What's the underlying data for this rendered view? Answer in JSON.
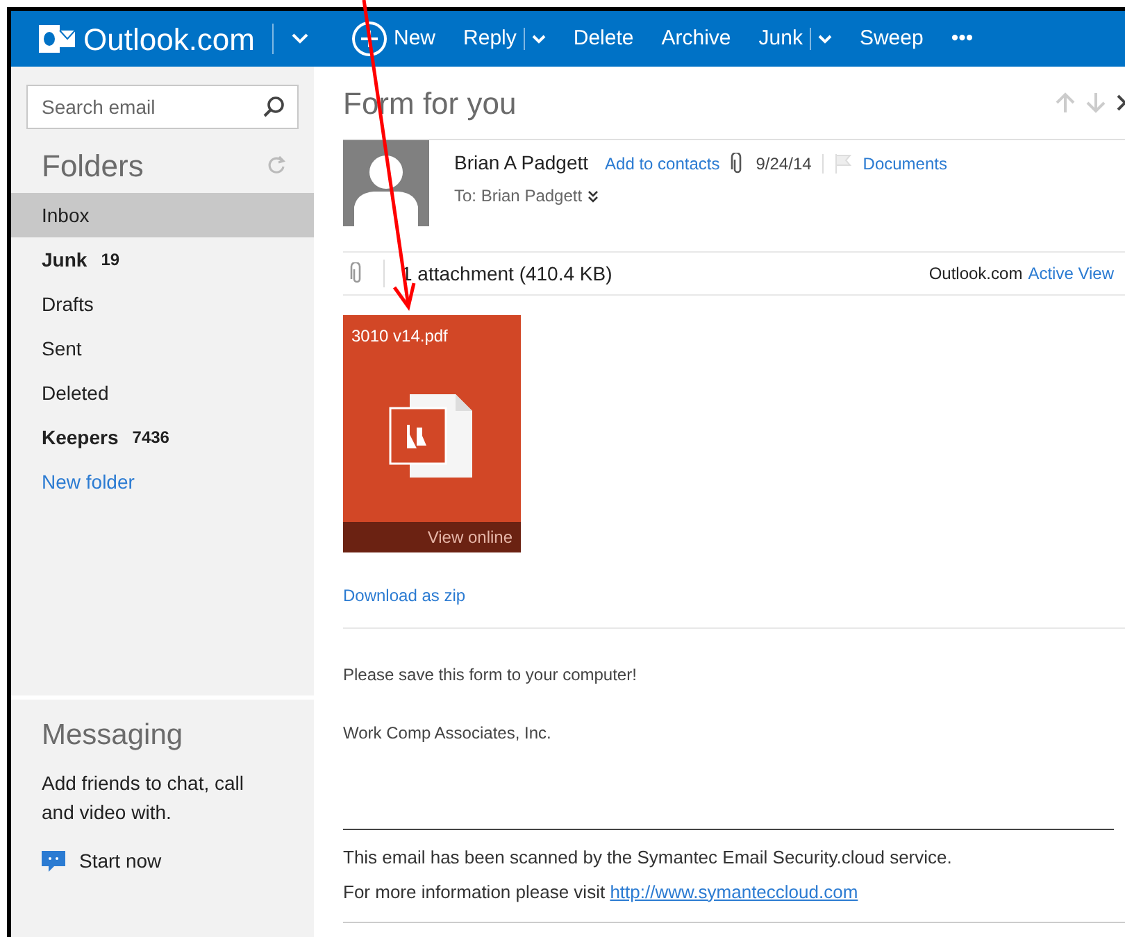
{
  "header": {
    "brand": "Outlook.com",
    "toolbar": [
      {
        "label": "New",
        "kind": "new",
        "has_menu": false
      },
      {
        "label": "Reply",
        "kind": "plain",
        "has_menu": true
      },
      {
        "label": "Delete",
        "kind": "plain",
        "has_menu": false
      },
      {
        "label": "Archive",
        "kind": "plain",
        "has_menu": false
      },
      {
        "label": "Junk",
        "kind": "plain",
        "has_menu": true
      },
      {
        "label": "Sweep",
        "kind": "plain",
        "has_menu": false
      },
      {
        "label": "•••",
        "kind": "plain",
        "has_menu": false
      }
    ]
  },
  "sidebar": {
    "search": {
      "placeholder": "Search email"
    },
    "folders_title": "Folders",
    "items": [
      {
        "label": "Inbox",
        "bold": false,
        "selected": true
      },
      {
        "label": "Junk",
        "count": "19",
        "bold": true,
        "selected": false
      },
      {
        "label": "Drafts",
        "bold": false,
        "selected": false
      },
      {
        "label": "Sent",
        "bold": false,
        "selected": false
      },
      {
        "label": "Deleted",
        "bold": false,
        "selected": false
      },
      {
        "label": "Keepers",
        "count": "7436",
        "bold": true,
        "selected": false
      }
    ],
    "new_folder": "New folder",
    "messaging": {
      "title": "Messaging",
      "text": "Add friends to chat, call and video with.",
      "action": "Start now"
    }
  },
  "message": {
    "subject": "Form for you",
    "sender": "Brian A Padgett",
    "add_contact": "Add to contacts",
    "date": "9/24/14",
    "category": "Documents",
    "to": "To: Brian Padgett",
    "attachments_summary": "1 attachment (410.4 KB)",
    "view_brand": "Outlook.com",
    "view_link": "Active View",
    "attachment": {
      "name": "3010 v14.pdf",
      "action": "View online"
    },
    "download": "Download as zip",
    "body": [
      "Please save this form to your computer!",
      "Work Comp Associates, Inc."
    ],
    "footer": {
      "line1": "This email has been scanned by the Symantec Email Security.cloud service.",
      "line2": "For more information please visit",
      "link": "http://www.symanteccloud.com"
    }
  }
}
